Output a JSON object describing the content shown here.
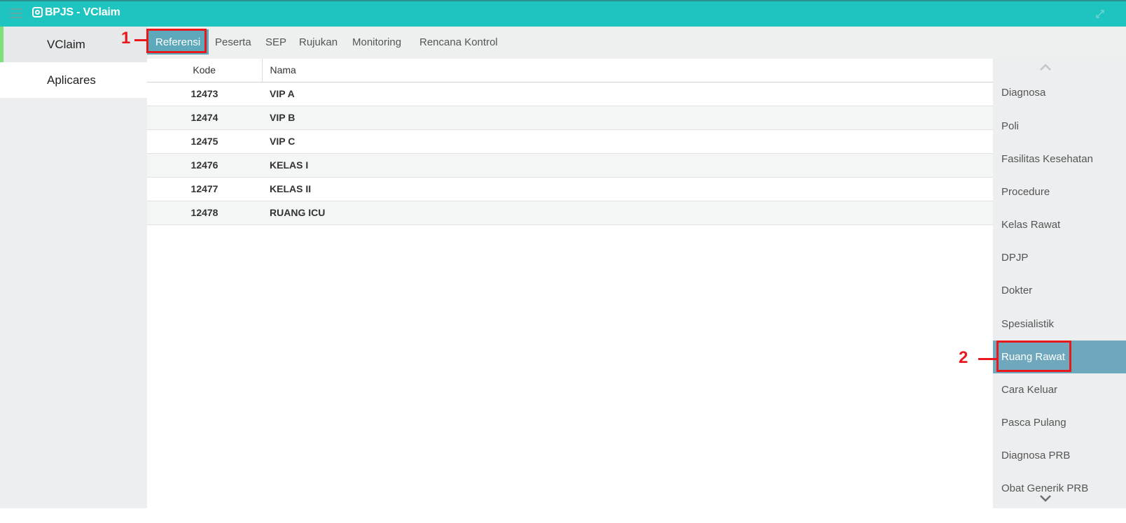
{
  "window": {
    "title": "BPJS - VClaim"
  },
  "icons": {
    "menu": "hamburger-icon",
    "logo": "bpjs-logo-icon",
    "expand": "expand-icon",
    "up": "chevron-up-icon",
    "down": "chevron-down-icon"
  },
  "leftnav": {
    "items": [
      {
        "label": "VClaim"
      },
      {
        "label": "Aplicares"
      }
    ]
  },
  "tabs": [
    {
      "label": "Referensi"
    },
    {
      "label": "Peserta"
    },
    {
      "label": "SEP"
    },
    {
      "label": "Rujukan"
    },
    {
      "label": "Monitoring"
    },
    {
      "label": "Rencana Kontrol"
    }
  ],
  "table": {
    "headers": {
      "kode": "Kode",
      "nama": "Nama"
    },
    "rows": [
      {
        "kode": "12473",
        "nama": "VIP A"
      },
      {
        "kode": "12474",
        "nama": "VIP B"
      },
      {
        "kode": "12475",
        "nama": "VIP C"
      },
      {
        "kode": "12476",
        "nama": "KELAS I"
      },
      {
        "kode": "12477",
        "nama": "KELAS II"
      },
      {
        "kode": "12478",
        "nama": "RUANG ICU"
      }
    ]
  },
  "rightnav": {
    "items": [
      {
        "label": "Diagnosa"
      },
      {
        "label": "Poli"
      },
      {
        "label": "Fasilitas Kesehatan"
      },
      {
        "label": "Procedure"
      },
      {
        "label": "Kelas Rawat"
      },
      {
        "label": "DPJP"
      },
      {
        "label": "Dokter"
      },
      {
        "label": "Spesialistik"
      },
      {
        "label": "Ruang Rawat"
      },
      {
        "label": "Cara Keluar"
      },
      {
        "label": "Pasca Pulang"
      },
      {
        "label": "Diagnosa PRB"
      },
      {
        "label": "Obat Generik PRB"
      }
    ]
  },
  "annotations": {
    "first": "1",
    "second": "2"
  },
  "colors": {
    "titlebar": "#1ec4bf",
    "active_tab": "#5da9bb",
    "active_menu": "#6fa8bd",
    "annotation": "#e8191d",
    "nav_accent": "#7de07a"
  }
}
